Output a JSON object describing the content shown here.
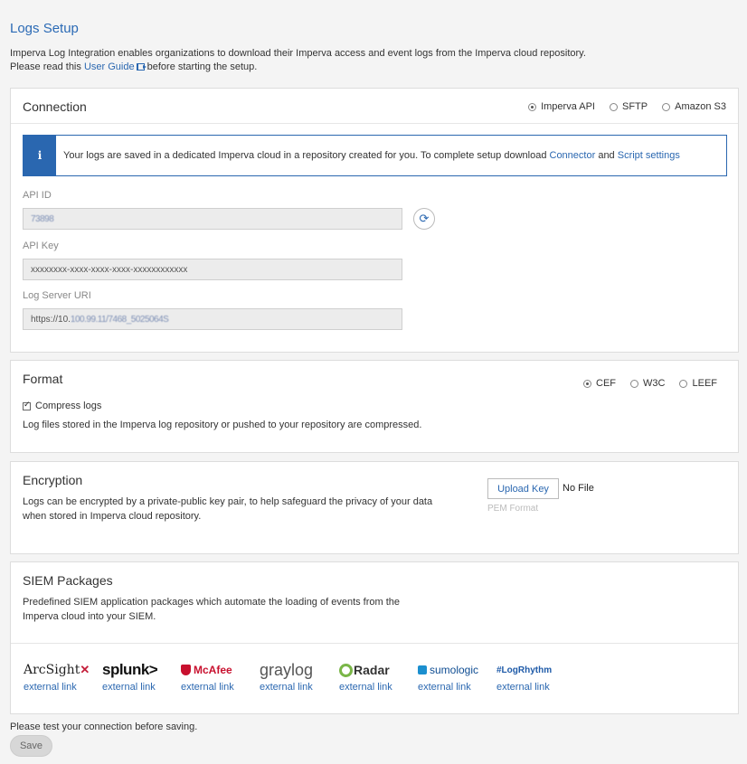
{
  "page": {
    "title": "Logs Setup",
    "intro_line1": "Imperva Log Integration enables organizations to download their Imperva access and event logs from the Imperva cloud repository.",
    "intro_line2_pre": "Please read this ",
    "intro_link": "User Guide",
    "intro_line2_post": " before starting the setup."
  },
  "connection": {
    "title": "Connection",
    "methods": [
      {
        "label": "Imperva API",
        "selected": true
      },
      {
        "label": "SFTP",
        "selected": false
      },
      {
        "label": "Amazon S3",
        "selected": false
      }
    ],
    "info_badge": "i",
    "info_text_pre": "Your logs are saved in a dedicated Imperva cloud in a repository created for you. To complete setup download ",
    "info_link_connector": "Connector",
    "info_text_and": " and ",
    "info_link_script": "Script settings",
    "api_id_label": "API ID",
    "api_id_value": "73898",
    "api_key_label": "API Key",
    "api_key_value": "xxxxxxxx-xxxx-xxxx-xxxx-xxxxxxxxxxxx",
    "log_server_label": "Log Server URI",
    "log_server_prefix": "https://10.",
    "log_server_blurred": "100.99.11/7468_5025064S"
  },
  "format": {
    "title": "Format",
    "options": [
      {
        "label": "CEF",
        "selected": true
      },
      {
        "label": "W3C",
        "selected": false
      },
      {
        "label": "LEEF",
        "selected": false
      }
    ],
    "compress_label": "Compress logs",
    "compress_checked": true,
    "description": "Log files stored in the Imperva log repository or pushed to your repository are compressed."
  },
  "encryption": {
    "title": "Encryption",
    "description_line1": "Logs can be encrypted by a private-public key pair, to help safeguard the privacy of your data",
    "description_line2": "when stored in Imperva cloud repository.",
    "upload_label": "Upload Key",
    "file_status": "No File",
    "format_hint": "PEM Format"
  },
  "siem": {
    "title": "SIEM Packages",
    "description_line1": "Predefined SIEM application packages which automate the loading of events from the",
    "description_line2": "Imperva cloud into your SIEM.",
    "packages": [
      {
        "name": "ArcSight",
        "logo_text": "ArcSight",
        "link": "external link"
      },
      {
        "name": "splunk",
        "logo_text": "splunk>",
        "link": "external link"
      },
      {
        "name": "McAfee",
        "logo_text": "McAfee",
        "link": "external link"
      },
      {
        "name": "graylog",
        "logo_text": "graylog",
        "link": "external link"
      },
      {
        "name": "QRadar",
        "logo_text": "Radar",
        "link": "external link"
      },
      {
        "name": "sumologic",
        "logo_text": "sumologic",
        "link": "external link"
      },
      {
        "name": "LogRhythm",
        "logo_text": "#LogRhythm",
        "link": "external link"
      }
    ]
  },
  "footer": {
    "note": "Please test your connection before saving.",
    "save_label": "Save"
  },
  "colors": {
    "accent": "#2a67b0",
    "background": "#f4f4f4"
  }
}
